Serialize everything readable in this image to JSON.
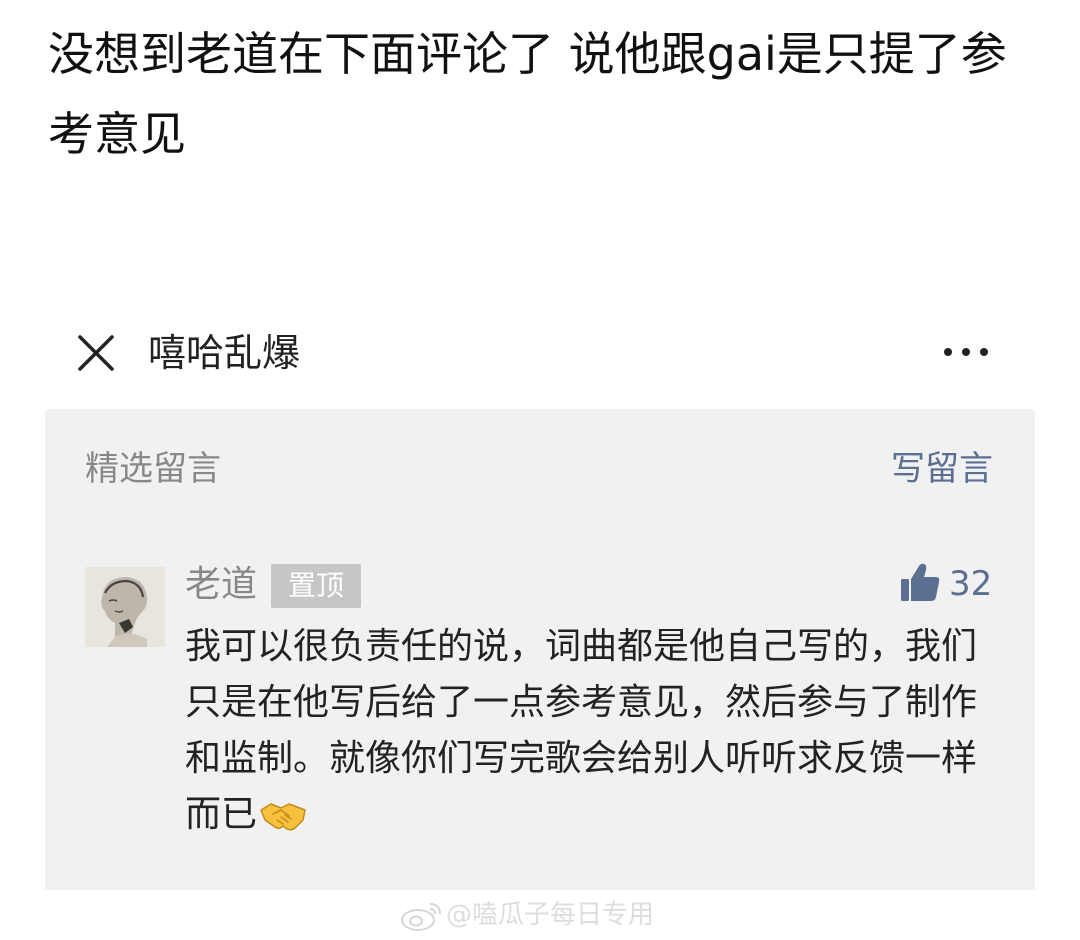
{
  "post": {
    "text": "没想到老道在下面评论了 说他跟gai是只提了参考意见"
  },
  "article_header": {
    "title": "嘻哈乱爆",
    "close_icon": "close-icon",
    "more_icon": "more-dots-icon"
  },
  "comments": {
    "section_title": "精选留言",
    "write_label": "写留言",
    "items": [
      {
        "author": "老道",
        "badge": "置顶",
        "likes": "32",
        "body": "我可以很负责任的说，词曲都是他自己写的，我们只是在他写后给了一点参考意见，然后参与了制作和监制。就像你们写完歌会给别人听听求反馈一样而已",
        "emoji": "handshake-emoji"
      }
    ]
  },
  "watermark": {
    "text": "@嗑瓜子每日专用",
    "icon": "weibo-icon"
  },
  "colors": {
    "link_blue": "#5b6f92",
    "panel_bg": "#f1f1f1",
    "muted_gray": "#888888",
    "badge_gray": "#c6c6c6"
  }
}
